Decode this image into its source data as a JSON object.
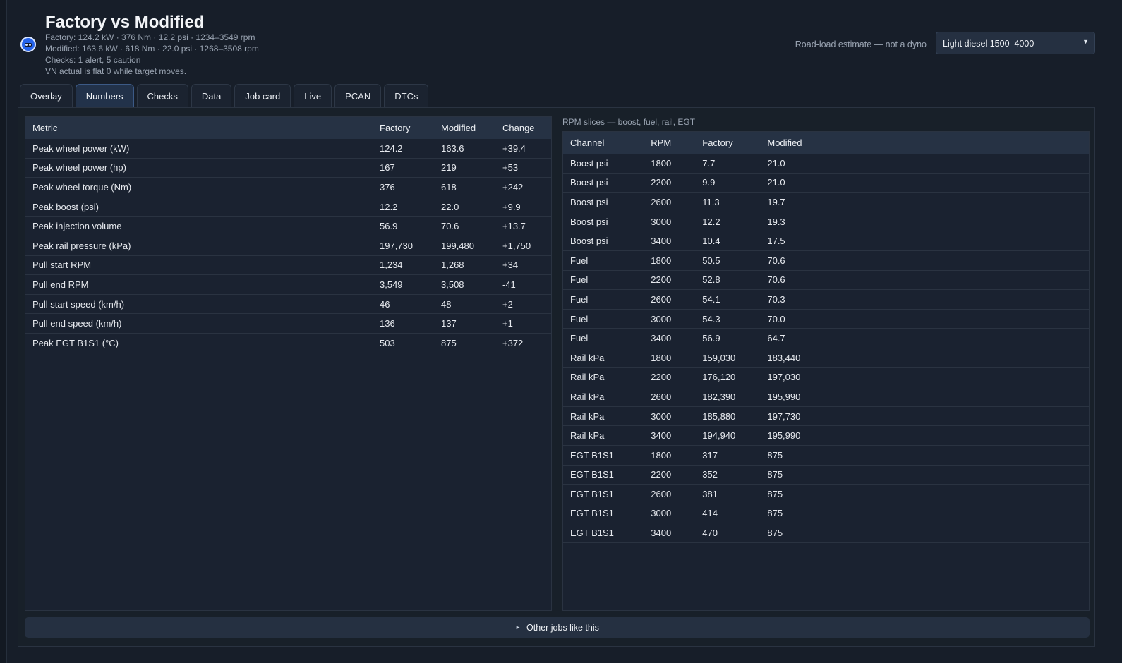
{
  "header": {
    "title": "Factory vs Modified",
    "factory_summary": "Factory: 124.2 kW  ·  376 Nm  ·  12.2 psi  ·  1234–3549 rpm",
    "modified_summary": "Modified: 163.6 kW  ·  618 Nm  ·  22.0 psi  ·  1268–3508 rpm",
    "checks_summary": "Checks: 1 alert, 5 caution",
    "vn_note": "VN actual is flat 0 while target moves.",
    "dyno_note": "Road-load estimate — not a dyno",
    "profile_select": "Light diesel 1500–4000"
  },
  "tabs": [
    "Overlay",
    "Numbers",
    "Checks",
    "Data",
    "Job card",
    "Live",
    "PCAN",
    "DTCs"
  ],
  "active_tab": "Numbers",
  "metrics_table": {
    "headers": [
      "Metric",
      "Factory",
      "Modified",
      "Change"
    ],
    "rows": [
      [
        "Peak wheel power (kW)",
        "124.2",
        "163.6",
        "+39.4"
      ],
      [
        "Peak wheel power (hp)",
        "167",
        "219",
        "+53"
      ],
      [
        "Peak wheel torque (Nm)",
        "376",
        "618",
        "+242"
      ],
      [
        "Peak boost (psi)",
        "12.2",
        "22.0",
        "+9.9"
      ],
      [
        "Peak injection volume",
        "56.9",
        "70.6",
        "+13.7"
      ],
      [
        "Peak rail pressure (kPa)",
        "197,730",
        "199,480",
        "+1,750"
      ],
      [
        "Pull start RPM",
        "1,234",
        "1,268",
        "+34"
      ],
      [
        "Pull end RPM",
        "3,549",
        "3,508",
        "-41"
      ],
      [
        "Pull start speed (km/h)",
        "46",
        "48",
        "+2"
      ],
      [
        "Pull end speed (km/h)",
        "136",
        "137",
        "+1"
      ],
      [
        "Peak EGT B1S1 (°C)",
        "503",
        "875",
        "+372"
      ]
    ]
  },
  "slices_table": {
    "caption": "RPM slices — boost, fuel, rail, EGT",
    "headers": [
      "Channel",
      "RPM",
      "Factory",
      "Modified"
    ],
    "rows": [
      [
        "Boost psi",
        "1800",
        "7.7",
        "21.0"
      ],
      [
        "Boost psi",
        "2200",
        "9.9",
        "21.0"
      ],
      [
        "Boost psi",
        "2600",
        "11.3",
        "19.7"
      ],
      [
        "Boost psi",
        "3000",
        "12.2",
        "19.3"
      ],
      [
        "Boost psi",
        "3400",
        "10.4",
        "17.5"
      ],
      [
        "Fuel",
        "1800",
        "50.5",
        "70.6"
      ],
      [
        "Fuel",
        "2200",
        "52.8",
        "70.6"
      ],
      [
        "Fuel",
        "2600",
        "54.1",
        "70.3"
      ],
      [
        "Fuel",
        "3000",
        "54.3",
        "70.0"
      ],
      [
        "Fuel",
        "3400",
        "56.9",
        "64.7"
      ],
      [
        "Rail kPa",
        "1800",
        "159,030",
        "183,440"
      ],
      [
        "Rail kPa",
        "2200",
        "176,120",
        "197,030"
      ],
      [
        "Rail kPa",
        "2600",
        "182,390",
        "195,990"
      ],
      [
        "Rail kPa",
        "3000",
        "185,880",
        "197,730"
      ],
      [
        "Rail kPa",
        "3400",
        "194,940",
        "195,990"
      ],
      [
        "EGT B1S1",
        "1800",
        "317",
        "875"
      ],
      [
        "EGT B1S1",
        "2200",
        "352",
        "875"
      ],
      [
        "EGT B1S1",
        "2600",
        "381",
        "875"
      ],
      [
        "EGT B1S1",
        "3000",
        "414",
        "875"
      ],
      [
        "EGT B1S1",
        "3400",
        "470",
        "875"
      ]
    ]
  },
  "footer": {
    "other_jobs_label": "Other jobs like this"
  },
  "icons": {
    "logo": "app-logo-icon",
    "select_chevron": "chevron-down-icon",
    "expand": "triangle-right-icon"
  }
}
